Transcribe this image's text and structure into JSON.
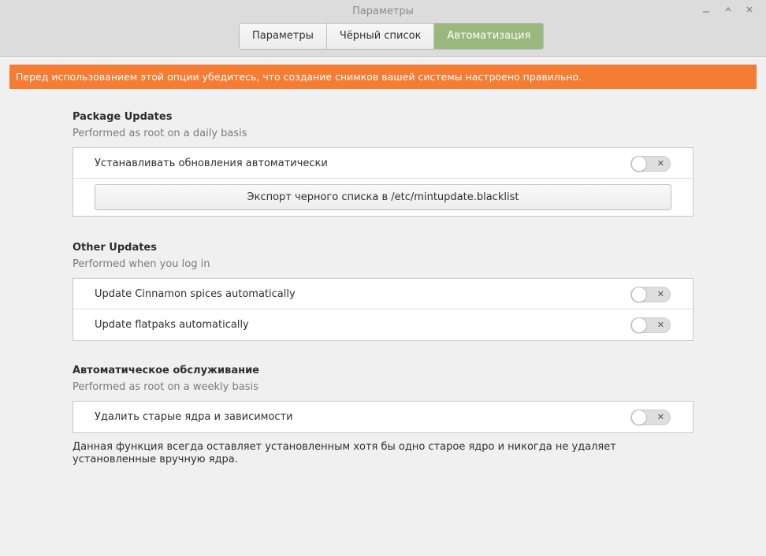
{
  "window": {
    "title": "Параметры",
    "controls": [
      "minimize-icon",
      "maximize-icon",
      "close-icon"
    ]
  },
  "tabs": [
    {
      "label": "Параметры",
      "active": false
    },
    {
      "label": "Чёрный список",
      "active": false
    },
    {
      "label": "Автоматизация",
      "active": true
    }
  ],
  "banner": {
    "text": "Перед использованием этой опции убедитесь, что создание снимков вашей системы настроено правильно.",
    "color": "#f47c33"
  },
  "sections": {
    "package_updates": {
      "title": "Package Updates",
      "subtitle": "Performed as root on a daily basis",
      "auto_install_label": "Устанавливать обновления автоматически",
      "auto_install_on": false,
      "export_button": "Экспорт черного списка в /etc/mintupdate.blacklist"
    },
    "other_updates": {
      "title": "Other Updates",
      "subtitle": "Performed when you log in",
      "cinnamon_label": "Update Cinnamon spices automatically",
      "cinnamon_on": false,
      "flatpak_label": "Update flatpaks automatically",
      "flatpak_on": false
    },
    "maintenance": {
      "title": "Автоматическое обслуживание",
      "subtitle": "Performed as root on a weekly basis",
      "remove_kernels_label": "Удалить старые ядра и зависимости",
      "remove_kernels_on": false,
      "note": "Данная функция всегда оставляет установленным хотя бы одно старое ядро и никогда не удаляет установленные вручную ядра."
    }
  },
  "colors": {
    "active_tab": "#9ab87c",
    "titlebar": "#dcdcdc",
    "background": "#f0f0f0"
  }
}
